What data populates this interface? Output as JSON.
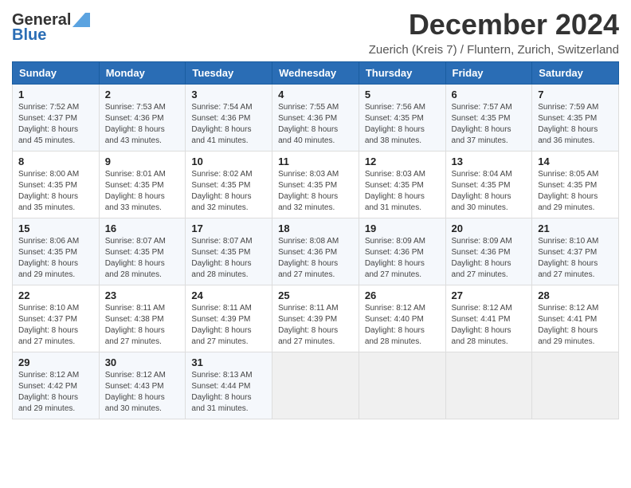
{
  "logo": {
    "general": "General",
    "blue": "Blue"
  },
  "title": "December 2024",
  "subtitle": "Zuerich (Kreis 7) / Fluntern, Zurich, Switzerland",
  "days_of_week": [
    "Sunday",
    "Monday",
    "Tuesday",
    "Wednesday",
    "Thursday",
    "Friday",
    "Saturday"
  ],
  "weeks": [
    [
      {
        "day": "1",
        "sunrise": "7:52 AM",
        "sunset": "4:37 PM",
        "daylight": "8 hours and 45 minutes."
      },
      {
        "day": "2",
        "sunrise": "7:53 AM",
        "sunset": "4:36 PM",
        "daylight": "8 hours and 43 minutes."
      },
      {
        "day": "3",
        "sunrise": "7:54 AM",
        "sunset": "4:36 PM",
        "daylight": "8 hours and 41 minutes."
      },
      {
        "day": "4",
        "sunrise": "7:55 AM",
        "sunset": "4:36 PM",
        "daylight": "8 hours and 40 minutes."
      },
      {
        "day": "5",
        "sunrise": "7:56 AM",
        "sunset": "4:35 PM",
        "daylight": "8 hours and 38 minutes."
      },
      {
        "day": "6",
        "sunrise": "7:57 AM",
        "sunset": "4:35 PM",
        "daylight": "8 hours and 37 minutes."
      },
      {
        "day": "7",
        "sunrise": "7:59 AM",
        "sunset": "4:35 PM",
        "daylight": "8 hours and 36 minutes."
      }
    ],
    [
      {
        "day": "8",
        "sunrise": "8:00 AM",
        "sunset": "4:35 PM",
        "daylight": "8 hours and 35 minutes."
      },
      {
        "day": "9",
        "sunrise": "8:01 AM",
        "sunset": "4:35 PM",
        "daylight": "8 hours and 33 minutes."
      },
      {
        "day": "10",
        "sunrise": "8:02 AM",
        "sunset": "4:35 PM",
        "daylight": "8 hours and 32 minutes."
      },
      {
        "day": "11",
        "sunrise": "8:03 AM",
        "sunset": "4:35 PM",
        "daylight": "8 hours and 32 minutes."
      },
      {
        "day": "12",
        "sunrise": "8:03 AM",
        "sunset": "4:35 PM",
        "daylight": "8 hours and 31 minutes."
      },
      {
        "day": "13",
        "sunrise": "8:04 AM",
        "sunset": "4:35 PM",
        "daylight": "8 hours and 30 minutes."
      },
      {
        "day": "14",
        "sunrise": "8:05 AM",
        "sunset": "4:35 PM",
        "daylight": "8 hours and 29 minutes."
      }
    ],
    [
      {
        "day": "15",
        "sunrise": "8:06 AM",
        "sunset": "4:35 PM",
        "daylight": "8 hours and 29 minutes."
      },
      {
        "day": "16",
        "sunrise": "8:07 AM",
        "sunset": "4:35 PM",
        "daylight": "8 hours and 28 minutes."
      },
      {
        "day": "17",
        "sunrise": "8:07 AM",
        "sunset": "4:35 PM",
        "daylight": "8 hours and 28 minutes."
      },
      {
        "day": "18",
        "sunrise": "8:08 AM",
        "sunset": "4:36 PM",
        "daylight": "8 hours and 27 minutes."
      },
      {
        "day": "19",
        "sunrise": "8:09 AM",
        "sunset": "4:36 PM",
        "daylight": "8 hours and 27 minutes."
      },
      {
        "day": "20",
        "sunrise": "8:09 AM",
        "sunset": "4:36 PM",
        "daylight": "8 hours and 27 minutes."
      },
      {
        "day": "21",
        "sunrise": "8:10 AM",
        "sunset": "4:37 PM",
        "daylight": "8 hours and 27 minutes."
      }
    ],
    [
      {
        "day": "22",
        "sunrise": "8:10 AM",
        "sunset": "4:37 PM",
        "daylight": "8 hours and 27 minutes."
      },
      {
        "day": "23",
        "sunrise": "8:11 AM",
        "sunset": "4:38 PM",
        "daylight": "8 hours and 27 minutes."
      },
      {
        "day": "24",
        "sunrise": "8:11 AM",
        "sunset": "4:39 PM",
        "daylight": "8 hours and 27 minutes."
      },
      {
        "day": "25",
        "sunrise": "8:11 AM",
        "sunset": "4:39 PM",
        "daylight": "8 hours and 27 minutes."
      },
      {
        "day": "26",
        "sunrise": "8:12 AM",
        "sunset": "4:40 PM",
        "daylight": "8 hours and 28 minutes."
      },
      {
        "day": "27",
        "sunrise": "8:12 AM",
        "sunset": "4:41 PM",
        "daylight": "8 hours and 28 minutes."
      },
      {
        "day": "28",
        "sunrise": "8:12 AM",
        "sunset": "4:41 PM",
        "daylight": "8 hours and 29 minutes."
      }
    ],
    [
      {
        "day": "29",
        "sunrise": "8:12 AM",
        "sunset": "4:42 PM",
        "daylight": "8 hours and 29 minutes."
      },
      {
        "day": "30",
        "sunrise": "8:12 AM",
        "sunset": "4:43 PM",
        "daylight": "8 hours and 30 minutes."
      },
      {
        "day": "31",
        "sunrise": "8:13 AM",
        "sunset": "4:44 PM",
        "daylight": "8 hours and 31 minutes."
      },
      null,
      null,
      null,
      null
    ]
  ]
}
